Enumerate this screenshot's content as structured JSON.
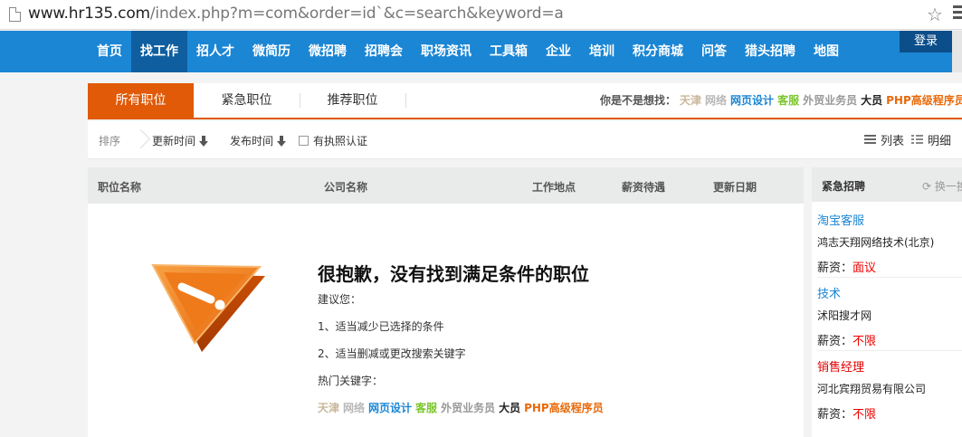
{
  "browser": {
    "url_host": "www.hr135.com",
    "url_rest": "/index.php?m=com&order=id`&c=search&keyword=a",
    "star_icon": "star-outline-icon",
    "menu_icon": "hamburger-menu-icon"
  },
  "nav": {
    "items": [
      "首页",
      "找工作",
      "招人才",
      "微简历",
      "微招聘",
      "招聘会",
      "职场资讯",
      "工具箱",
      "企业",
      "培训",
      "积分商城",
      "问答",
      "猎头招聘",
      "地图"
    ],
    "active_index": 1,
    "login_label": "登录"
  },
  "tabs": {
    "items": [
      "所有职位",
      "紧急职位",
      "推荐职位"
    ],
    "active_index": 0,
    "suggest_label": "你是不是想找：",
    "suggest_keywords": [
      {
        "text": "天津",
        "color": "#c9b79a"
      },
      {
        "text": "网络",
        "color": "#b8b8b8"
      },
      {
        "text": "网页设计",
        "color": "#1b86d4"
      },
      {
        "text": "客服",
        "color": "#7bc62d"
      },
      {
        "text": "外贸业务员",
        "color": "#999999"
      },
      {
        "text": "大员",
        "color": "#222222"
      },
      {
        "text": "PHP高级程序员",
        "color": "#e86a0a"
      }
    ]
  },
  "sortbar": {
    "label": "排序",
    "update_time": "更新时间",
    "publish_time": "发布时间",
    "license_label": "有执照认证",
    "view_list": "列表",
    "view_detail": "明细"
  },
  "table": {
    "headers": [
      "职位名称",
      "公司名称",
      "工作地点",
      "薪资待遇",
      "更新日期"
    ]
  },
  "empty": {
    "title": "很抱歉，没有找到满足条件的职位",
    "suggest": "建议您：",
    "tip1": "1、适当减少已选择的条件",
    "tip2": "2、适当删减或更改搜索关键字",
    "hot_label": "热门关键字："
  },
  "sidebar": {
    "title": "紧急招聘",
    "refresh_label": "换一换",
    "salary_label": "薪资：",
    "jobs": [
      {
        "title": "淘宝客服",
        "title_color": "#1b86d4",
        "company": "鸿志天翔网络技术(北京)",
        "salary": "面议"
      },
      {
        "title": "技术",
        "title_color": "#1b86d4",
        "company": "沭阳搜才网",
        "salary": "不限"
      },
      {
        "title": "销售经理",
        "title_color": "#e00000",
        "company": "河北宾翔贸易有限公司",
        "salary": "不限"
      }
    ]
  },
  "colors": {
    "nav_blue": "#1b86d4",
    "active_nav": "#0f5fa0",
    "tab_orange": "#e05a08",
    "salary_red": "#e00000"
  }
}
